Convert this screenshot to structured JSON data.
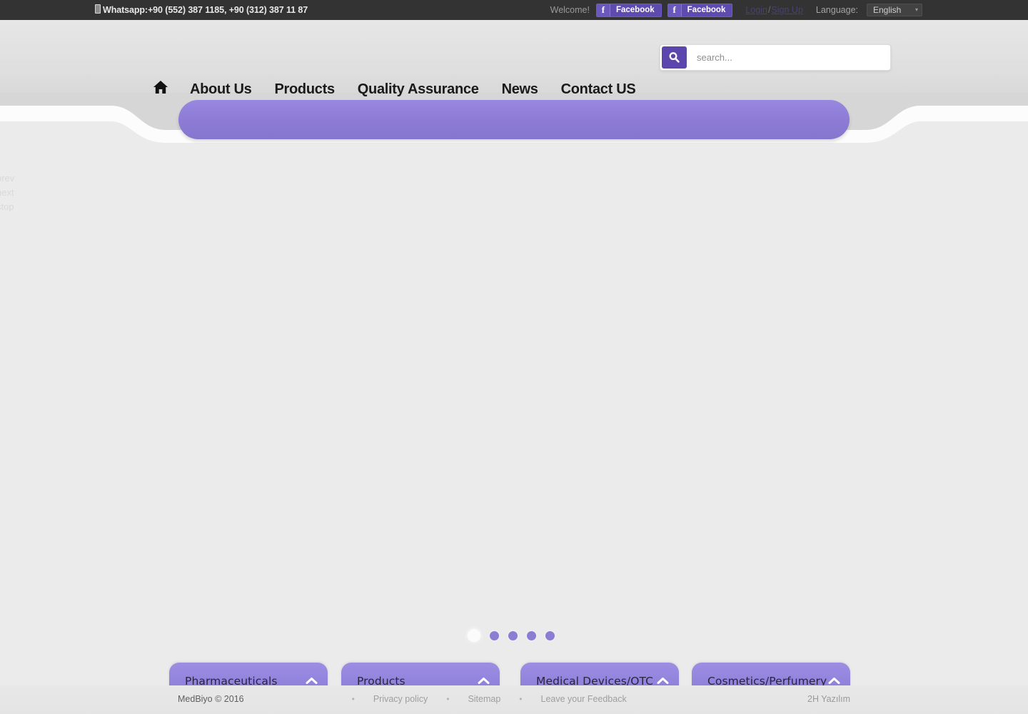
{
  "topbar": {
    "phone_icon": "mobile-phone-icon",
    "phone": "Whatsapp:+90 (552) 387 1185, +90 (312) 387 11 87",
    "welcome": "Welcome!",
    "facebook_buttons": [
      {
        "glyph": "f",
        "label": "Facebook"
      },
      {
        "glyph": "f",
        "label": "Facebook"
      }
    ],
    "login": "Login",
    "auth_separator": "/",
    "signup": "Sign Up",
    "language_label": "Language:",
    "language_value": "English",
    "language_caret": "▾"
  },
  "search": {
    "placeholder": "search...",
    "value": "",
    "icon": "search-icon"
  },
  "nav": {
    "home_icon": "home-icon",
    "items": [
      {
        "label": "About Us"
      },
      {
        "label": "Products"
      },
      {
        "label": "Quality Assurance"
      },
      {
        "label": "News"
      },
      {
        "label": "Contact US"
      }
    ]
  },
  "slider": {
    "controls": [
      {
        "label": "prev"
      },
      {
        "label": "next"
      },
      {
        "label": "stop"
      }
    ],
    "dots": [
      {
        "active": true
      },
      {
        "active": false
      },
      {
        "active": false
      },
      {
        "active": false
      },
      {
        "active": false
      }
    ]
  },
  "categories": [
    {
      "label": "Pharmaceuticals",
      "chevron": "chevron-up-icon"
    },
    {
      "label": "Products",
      "chevron": "chevron-up-icon"
    },
    {
      "label": "Medical Devices/OTC",
      "chevron": "chevron-up-icon"
    },
    {
      "label": "Cosmetics/Perfumery",
      "chevron": "chevron-up-icon"
    }
  ],
  "footer": {
    "copyright": "MedBiyo © 2016",
    "bullet": "•",
    "links": [
      {
        "label": "Privacy policy"
      },
      {
        "label": "Sitemap"
      },
      {
        "label": "Leave your Feedback"
      }
    ],
    "credit": "2H Yazılım"
  },
  "colors": {
    "accent_purple": "#8d7bd6",
    "accent_purple_dark": "#5b46ad",
    "topbar_bg": "#333333",
    "page_bg": "#ebebeb",
    "header_bg": "#e0e0e0"
  }
}
